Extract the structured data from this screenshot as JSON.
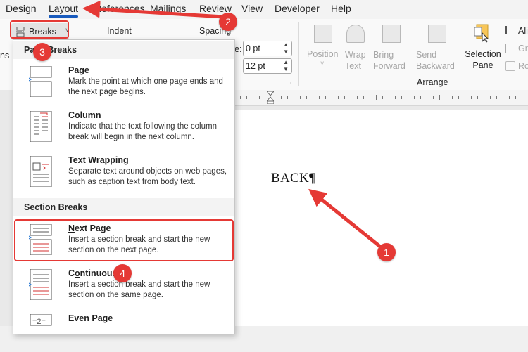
{
  "tabs": [
    "Design",
    "Layout",
    "References",
    "Mailings",
    "Review",
    "View",
    "Developer",
    "Help"
  ],
  "active_tab": "Layout",
  "ribbon": {
    "breaks_label": "Breaks",
    "indent_label": "Indent",
    "spacing_label": "Spacing",
    "spacing_before": "0 pt",
    "spacing_after": "12 pt",
    "left_cut": "ns",
    "position_label": "Position",
    "wrap_text_label": "Wrap Text",
    "bring_forward_label": "Bring Forward",
    "send_backward_label": "Send Backward",
    "selection_pane_label": "Selection Pane",
    "arrange_group_label": "Arrange",
    "right_cut": [
      "Ali",
      "Gr",
      "Ro"
    ],
    "spacing_prefix": "e:"
  },
  "menu": {
    "page_breaks_header": "Page Breaks",
    "section_breaks_header": "Section Breaks",
    "items": [
      {
        "title": "Page",
        "underline": "P",
        "desc": "Mark the point at which one page ends and the next page begins."
      },
      {
        "title": "Column",
        "underline": "C",
        "desc": "Indicate that the text following the column break will begin in the next column."
      },
      {
        "title": "Text Wrapping",
        "underline": "T",
        "desc": "Separate text around objects on web pages, such as caption text from body text."
      },
      {
        "title": "Next Page",
        "underline": "N",
        "desc": "Insert a section break and start the new section on the next page."
      },
      {
        "title": "Continuous",
        "underline": "o",
        "desc": "Insert a section break and start the new section on the same page."
      },
      {
        "title": "Even Page",
        "underline": "E",
        "desc": ""
      }
    ]
  },
  "document": {
    "text": "BACK¶"
  },
  "callouts": [
    "1",
    "2",
    "3",
    "4"
  ],
  "colors": {
    "accent": "#185abd",
    "callout": "#e53935"
  }
}
